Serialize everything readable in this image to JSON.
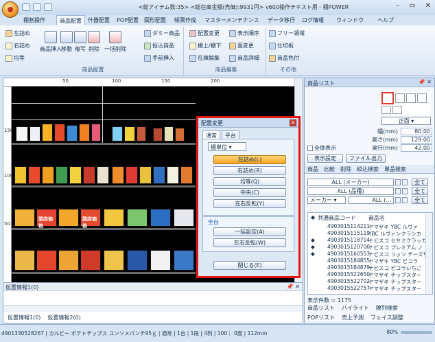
{
  "window": {
    "title": "<総アイテム数:35> <総在庫金額(売価):9931円> v600操作テキスト用 - 棚POWER",
    "min": "–",
    "max": "▭",
    "close": "✕"
  },
  "menu": [
    {
      "label": "棚割操作"
    },
    {
      "label": "商品配置",
      "active": true
    },
    {
      "label": "什器配置"
    },
    {
      "label": "POP配置"
    },
    {
      "label": "図形配置"
    },
    {
      "label": "帳票作成"
    },
    {
      "label": "マスターメンテナンス"
    },
    {
      "label": "データ移行"
    },
    {
      "label": "ログ情報"
    },
    {
      "label": "ウィンドウ"
    },
    {
      "label": "ヘルプ"
    }
  ],
  "ribbon": {
    "group1_label": "商品配置",
    "group2_label": "商品編集",
    "group3_label": "その他",
    "g1_small": [
      "左詰め",
      "右詰め",
      "均等"
    ],
    "g1_big": [
      "商品挿入",
      "移動",
      "複写",
      "削除",
      "一括削除"
    ],
    "g1_right": [
      "ダミー商品",
      "投込商品",
      "手前挿入"
    ],
    "g2_items": [
      "配置変更",
      "表示順序",
      "棚上/棚下",
      "面変更",
      "在庫編集",
      "商品詳細"
    ],
    "g3_items": [
      "フリー領域",
      "仕切板",
      "商品色付"
    ]
  },
  "ruler": {
    "h": [
      "50",
      "100",
      "150",
      "200"
    ],
    "v": [
      "150",
      "100",
      "50"
    ]
  },
  "planogram": {
    "pop_labels": [
      "閉店価格",
      "閉店価格"
    ]
  },
  "dialog": {
    "title": "配置変更",
    "tabs": [
      "通常",
      "平台"
    ],
    "unit": "棚単位",
    "buttons": [
      "左詰め(L)",
      "右詰め(R)",
      "均等(Q)",
      "中央(C)",
      "左右反転(Y)"
    ],
    "section2": "全台",
    "buttons2": [
      "一括設定(A)",
      "左右反転(W)"
    ],
    "close": "閉じる(E)"
  },
  "bottom": {
    "title": "仮置情報1(0)",
    "pin": "📌 ✕",
    "tabs": [
      "仮置情報1(0)",
      "仮置情報2(0)"
    ]
  },
  "right": {
    "title": "商品リスト",
    "pin": "📌 ✕",
    "face": "正面",
    "dims": [
      {
        "label": "幅(mm)",
        "value": "80.00"
      },
      {
        "label": "高さ(mm)",
        "value": "129.00"
      },
      {
        "label": "奥行(mm)",
        "value": "42.00"
      }
    ],
    "showall": "全体表示",
    "btn_display": "表示設定",
    "btn_export": "ファイル出力",
    "tabs": [
      "商品",
      "比較",
      "削除",
      "絞込検索",
      "単品検索"
    ],
    "filter1": "ALL (メーカー)",
    "filter2": "ALL (品種)",
    "filter3a": "メーカー",
    "filter3b": "ALL (...",
    "all": "全て",
    "list_header": {
      "code": "共通商品コード",
      "name": "商品名"
    },
    "rows": [
      {
        "dot": "",
        "code": "4903015114211",
        "name": "ヤマザキ YBC ルヴァ"
      },
      {
        "dot": "",
        "code": "4903015115119",
        "name": "YBC ルヴァンクラシカ"
      },
      {
        "dot": "◆",
        "code": "4903015118714",
        "name": "ナビスコ セサミクラッカ"
      },
      {
        "dot": "◆",
        "code": "4903015120700",
        "name": "ナビスコ プレミアム ノ"
      },
      {
        "dot": "◆",
        "code": "4903015160553",
        "name": "ナビスコ リッツ チーズサ"
      },
      {
        "dot": "",
        "code": "4903015184855",
        "name": "ヤマザキ YBC ピコラ"
      },
      {
        "dot": "",
        "code": "4903015184879",
        "name": "ナビスコ ピコラいちご"
      },
      {
        "dot": "",
        "code": "4903015522650",
        "name": "ヤマザキ チップスター"
      },
      {
        "dot": "",
        "code": "4903015522702",
        "name": "ヤマザキ チップスター"
      },
      {
        "dot": "",
        "code": "4903015522757",
        "name": "ヤマザキ チップスター"
      }
    ],
    "count": "表示件数 = 1175",
    "tabs2": [
      "商品リスト",
      "ハイライト",
      "陳列検索"
    ],
    "tabs3": [
      "POPリスト",
      "売上予測",
      "フェイス調整"
    ]
  },
  "status": {
    "text": "4901330528267 | カルビー ポテトチップス コンソメパンチ95ｇ | 通常 | 1台 | 1段 | 4列 | 100｜ 0度 | 112mm",
    "zoom": "80%"
  }
}
